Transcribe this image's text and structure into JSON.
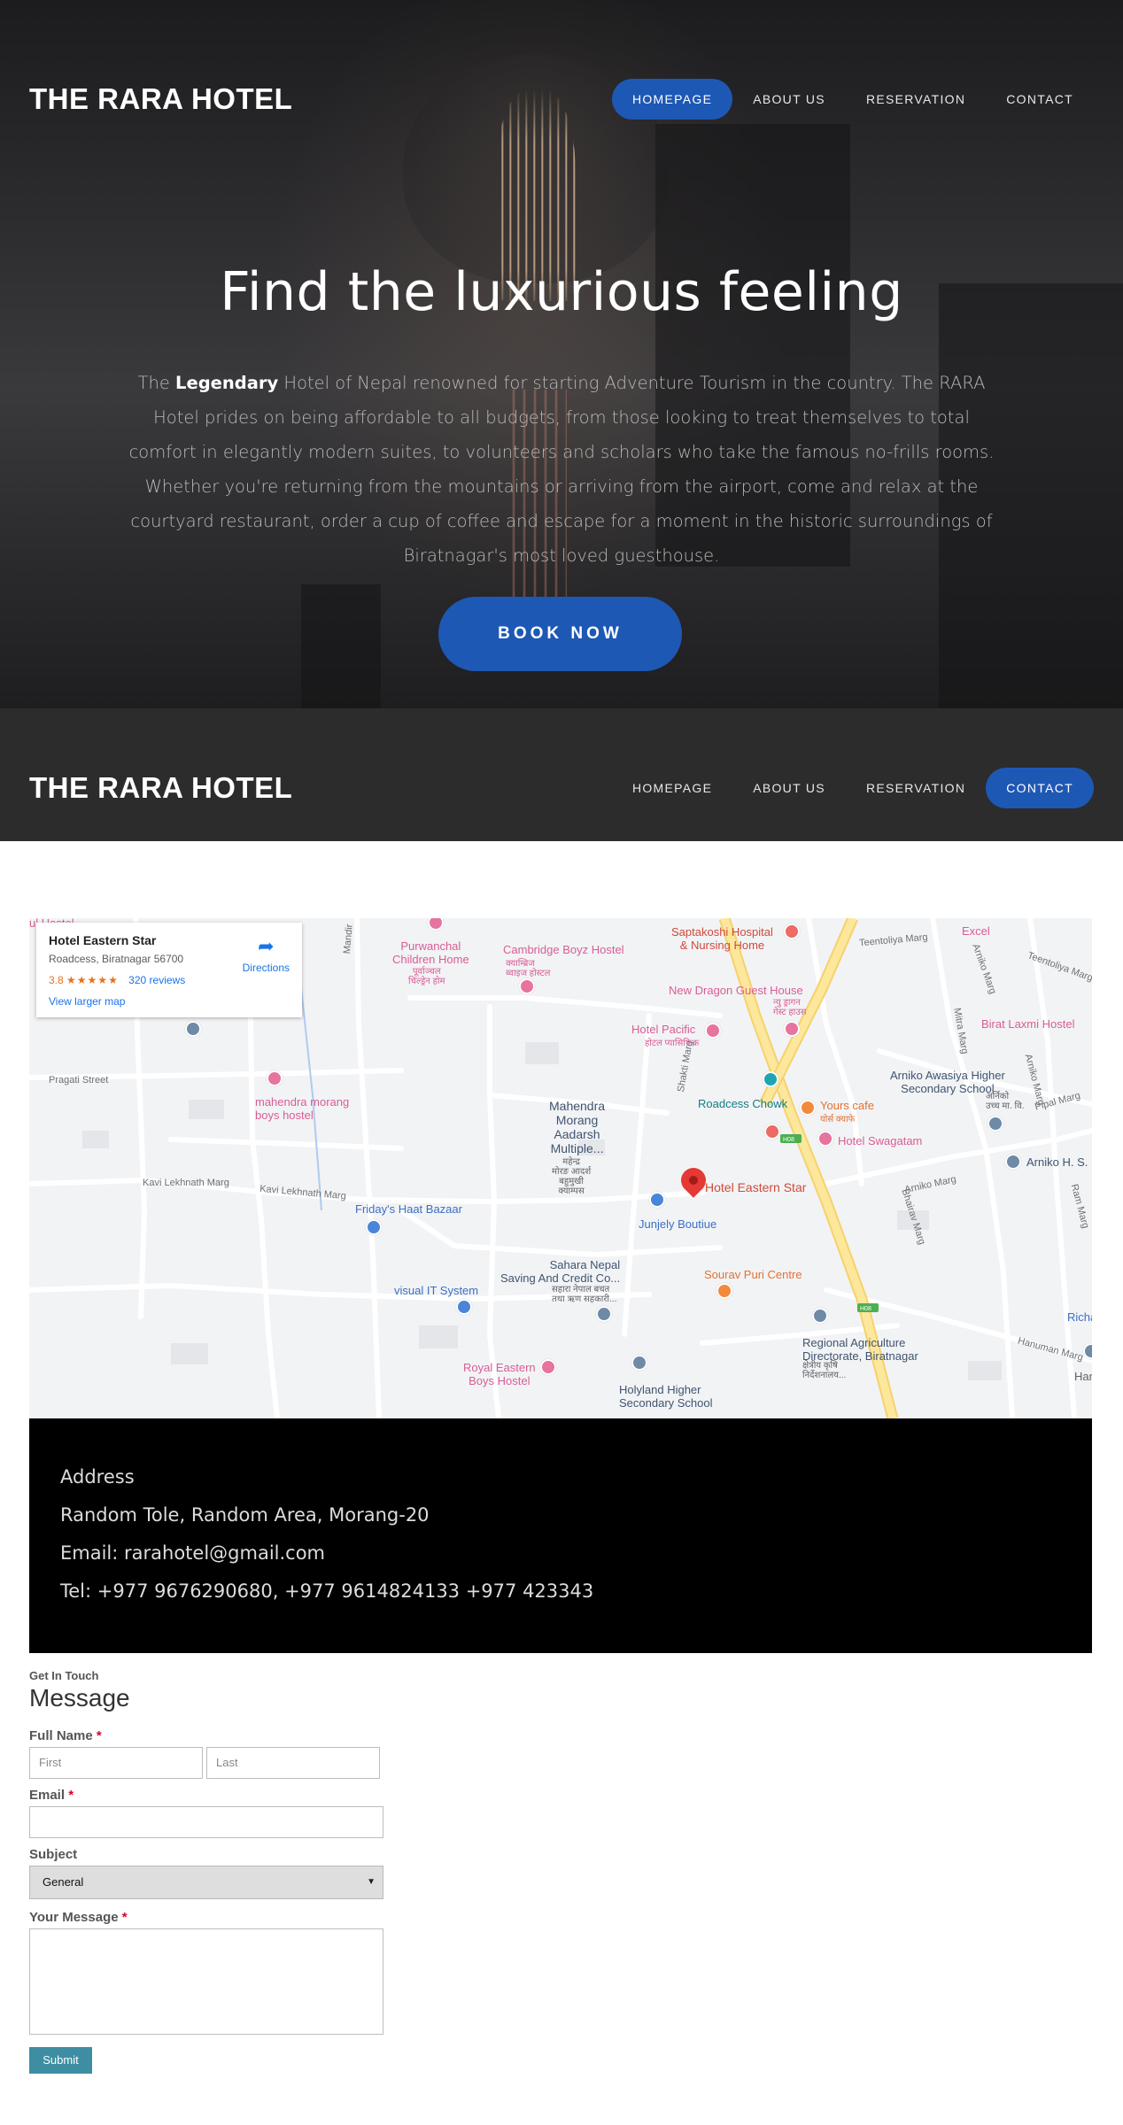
{
  "brand": "THE RARA HOTEL",
  "nav": [
    "HOMEPAGE",
    "ABOUT US",
    "RESERVATION",
    "CONTACT"
  ],
  "hero": {
    "title": "Find the luxurious feeling",
    "text_prefix": "The ",
    "text_bold": "Legendary",
    "text_rest": " Hotel of Nepal renowned for starting Adventure Tourism in the country. The RARA Hotel prides on being affordable to all budgets, from those looking to treat themselves to total comfort in elegantly modern suites, to volunteers and scholars who take the famous no-frills rooms. Whether you're returning from the mountains or arriving from the airport, come and relax at the courtyard restaurant, order a cup of coffee and escape for a moment in the historic surroundings of Biratnagar's most loved guesthouse.",
    "cta": "BOOK NOW"
  },
  "map": {
    "card": {
      "name": "Hotel Eastern Star",
      "address": "Roadcess, Biratnagar 56700",
      "rating": "3.8",
      "stars": "★★★★★",
      "reviews": "320 reviews",
      "larger": "View larger map",
      "directions": "Directions"
    },
    "labels": {
      "hotel_top_left": "ul Hostel",
      "purwanchal": "Purwanchal\nChildren Home",
      "purwanchal_np": "पूर्वाञ्चल\nचिल्ड्रेन होम",
      "cambridge": "Cambridge Boyz Hostel",
      "cambridge_np": "क्याम्ब्रिज\nब्वाइज होस्टल",
      "saptakoshi": "Saptakoshi Hospital\n& Nursing Home",
      "teentoliya": "Teentoliya Marg",
      "excel": "Excel",
      "new_dragon": "New Dragon Guest House",
      "new_dragon_np": "न्यु ड्रागन\nगेस्ट हाउस",
      "birat_laxmi": "Birat Laxmi Hostel",
      "hotel_pacific": "Hotel Pacific",
      "hotel_pacific_np": "होटल प्यासिफिक",
      "pragati": "Pragati Street",
      "mahendra_hostel": "mahendra morang\nboys hostel",
      "arniko_school": "Arniko Awasiya Higher\nSecondary School",
      "arniko_school_np": "अर्निको\nउच्च मा. वि.",
      "roadcess": "Roadcess Chowk",
      "yours_cafe": "Yours cafe",
      "yours_cafe_np": "योर्स क्याफे",
      "mahendra_campus": "Mahendra\nMorang\nAadarsh\nMultiple...",
      "mahendra_campus_np": "महेन्द्र\nमोरङ आदर्श\nबहुमुखी\nक्याम्पस",
      "hotel_swagatam": "Hotel Swagatam",
      "arniko_hs": "Arniko H. S.",
      "pipal": "Pipal Marg",
      "kavi1": "Kavi Lekhnath Marg",
      "kavi2": "Kavi Lekhnath Marg",
      "fridays": "Friday's Haat Bazaar",
      "eastern_star": "Hotel Eastern Star",
      "junjely": "Junjely Boutiue",
      "sahara": "Sahara Nepal\nSaving And Credit Co...",
      "sahara_np": "सहारा नेपाल बचत\nतथा ऋण सहकारी...",
      "sourav": "Sourav Puri Centre",
      "visual_it": "visual IT System",
      "regional": "Regional Agriculture\nDirectorate, Biratnagar",
      "regional_np": "क्षेत्रीय कृषि\nनिर्देशनालय...",
      "royal": "Royal Eastern\nBoys Hostel",
      "holyland": "Holyland Higher\nSecondary School",
      "hanuman": "Hanuman Marg",
      "richa": "Richa",
      "har": "Har",
      "shakti": "Shakti Marg",
      "mandir": "Mandir",
      "bhairav": "Bhairav Marg",
      "arniko_marg": "Arniko Marg",
      "arniko_marg2": "Arniko Marg",
      "mitra": "Mitra Marg",
      "ram": "Ram Marg",
      "h08a": "H08",
      "h08b": "H08"
    }
  },
  "address": {
    "heading": "Address",
    "line1": "Random Tole, Random Area, Morang-20",
    "email": "Email: rarahotel@gmail.com",
    "tel": "Tel: +977 9676290680, +977 9614824133 +977 423343"
  },
  "form": {
    "eyebrow": "Get In Touch",
    "title": "Message",
    "full_name": "Full Name",
    "required": "*",
    "first_ph": "First",
    "last_ph": "Last",
    "email": "Email",
    "subject": "Subject",
    "subject_value": "General",
    "message": "Your Message",
    "submit": "Submit"
  },
  "colors": {
    "accent": "#1e58b5",
    "hero_dark": "#2c2c2c",
    "submit": "#3e8ea3"
  }
}
